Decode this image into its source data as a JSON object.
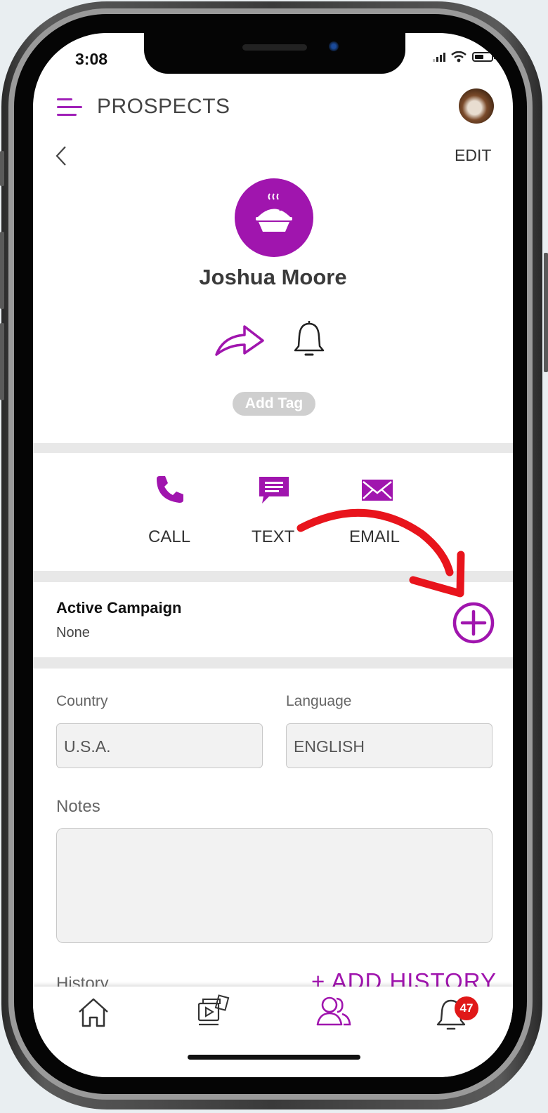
{
  "status_bar": {
    "time": "3:08"
  },
  "header": {
    "title": "PROSPECTS",
    "edit_label": "EDIT"
  },
  "profile": {
    "name": "Joshua Moore",
    "add_tag_label": "Add Tag"
  },
  "actions": [
    {
      "label": "CALL",
      "icon": "phone-icon"
    },
    {
      "label": "TEXT",
      "icon": "message-icon"
    },
    {
      "label": "EMAIL",
      "icon": "envelope-icon"
    }
  ],
  "campaign": {
    "title": "Active Campaign",
    "value": "None"
  },
  "form": {
    "country_label": "Country",
    "country_value": "U.S.A.",
    "language_label": "Language",
    "language_value": "ENGLISH",
    "notes_label": "Notes",
    "notes_value": ""
  },
  "history": {
    "label": "History",
    "add_label": "+ ADD HISTORY"
  },
  "bottom_nav": {
    "items": [
      {
        "icon": "home-icon"
      },
      {
        "icon": "media-icon"
      },
      {
        "icon": "contacts-icon",
        "active": true
      },
      {
        "icon": "bell-icon"
      }
    ],
    "notification_count": "47"
  },
  "colors": {
    "accent": "#a015ae",
    "badge": "#e01818",
    "annotation": "#e8141c"
  }
}
